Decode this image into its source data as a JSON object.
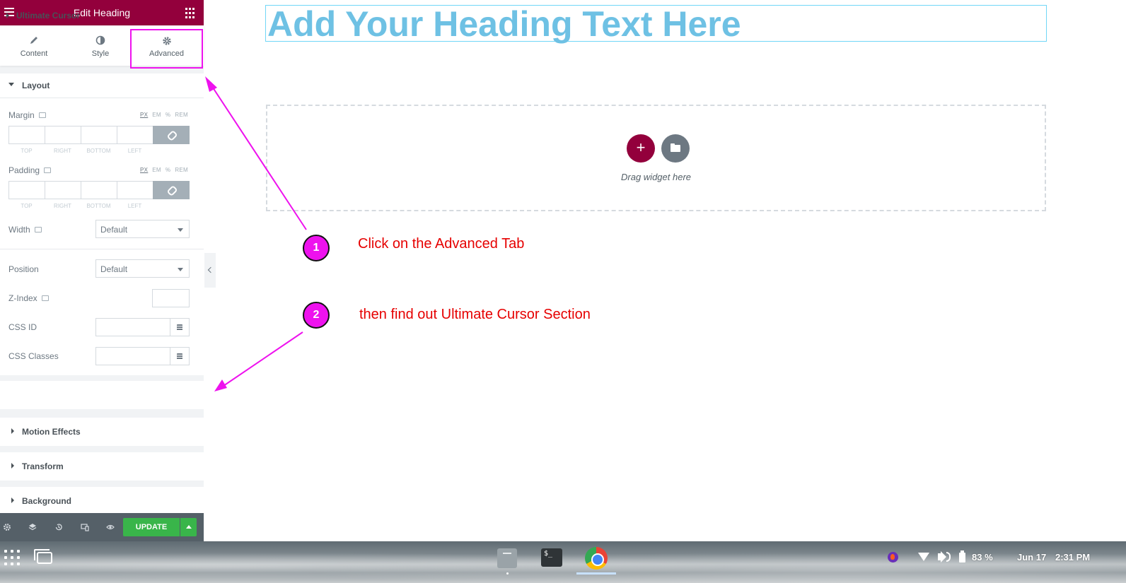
{
  "panel": {
    "title": "Edit Heading",
    "tabs": [
      {
        "label": "Content"
      },
      {
        "label": "Style"
      },
      {
        "label": "Advanced"
      }
    ],
    "layout_section": {
      "title": "Layout",
      "margin": {
        "label": "Margin",
        "units": [
          "PX",
          "EM",
          "%",
          "REM"
        ],
        "sides": [
          "TOP",
          "RIGHT",
          "BOTTOM",
          "LEFT"
        ]
      },
      "padding": {
        "label": "Padding",
        "units": [
          "PX",
          "EM",
          "%",
          "REM"
        ],
        "sides": [
          "TOP",
          "RIGHT",
          "BOTTOM",
          "LEFT"
        ]
      },
      "width": {
        "label": "Width",
        "value": "Default"
      },
      "position": {
        "label": "Position",
        "value": "Default"
      },
      "z_index": {
        "label": "Z-Index"
      },
      "css_id": {
        "label": "CSS ID"
      },
      "css_classes": {
        "label": "CSS Classes"
      }
    },
    "sections": [
      {
        "title": "Ultimate Cursor"
      },
      {
        "title": "Motion Effects"
      },
      {
        "title": "Transform"
      },
      {
        "title": "Background"
      }
    ],
    "footer": {
      "update_label": "UPDATE"
    }
  },
  "canvas": {
    "heading": "Add Your Heading Text Here",
    "add_button": "+",
    "drag_text": "Drag widget here"
  },
  "annotations": [
    {
      "number": "1",
      "text": "Click on the Advanced Tab"
    },
    {
      "number": "2",
      "text": "then find out Ultimate Cursor Section"
    }
  ],
  "taskbar": {
    "terminal_glyph": "$_",
    "battery": "83 %",
    "date": "Jun 17",
    "time": "2:31 PM"
  },
  "colors": {
    "brand": "#93003c",
    "heading": "#6ec1e4",
    "annotation": "#ee12ee",
    "note_text": "#e60000",
    "update": "#39b54a"
  }
}
